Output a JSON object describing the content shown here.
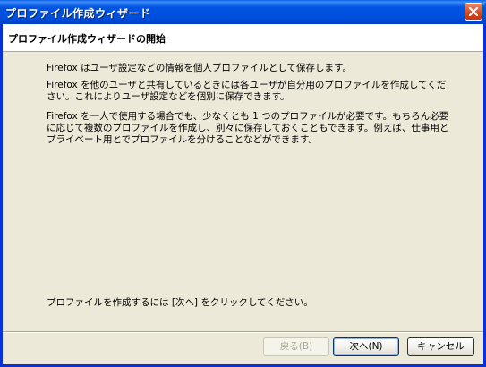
{
  "window": {
    "title": "プロファイル作成ウィザード"
  },
  "header": {
    "heading": "プロファイル作成ウィザードの開始"
  },
  "body": {
    "paragraphs": [
      "Firefox はユーザ設定などの情報を個人プロファイルとして保存します。",
      "Firefox を他のユーザと共有しているときには各ユーザが自分用のプロファイルを作成してください。これによりユーザ設定などを個別に保存できます。",
      "Firefox を一人で使用する場合でも、少なくとも 1 つのプロファイルが必要です。もちろん必要に応じて複数のプロファイルを作成し、別々に保存しておくこともできます。例えば、仕事用とプライベート用とでプロファイルを分けることなどができます。"
    ],
    "instruction": "プロファイルを作成するには [次へ] をクリックしてください。"
  },
  "buttons": {
    "back": "戻る(B)",
    "next": "次へ(N)",
    "cancel": "キャンセル"
  },
  "icons": {
    "close": "close-icon"
  },
  "colors": {
    "titlebar": "#0053e1",
    "dialog_bg": "#ece9d8",
    "close_button": "#d9431c"
  }
}
